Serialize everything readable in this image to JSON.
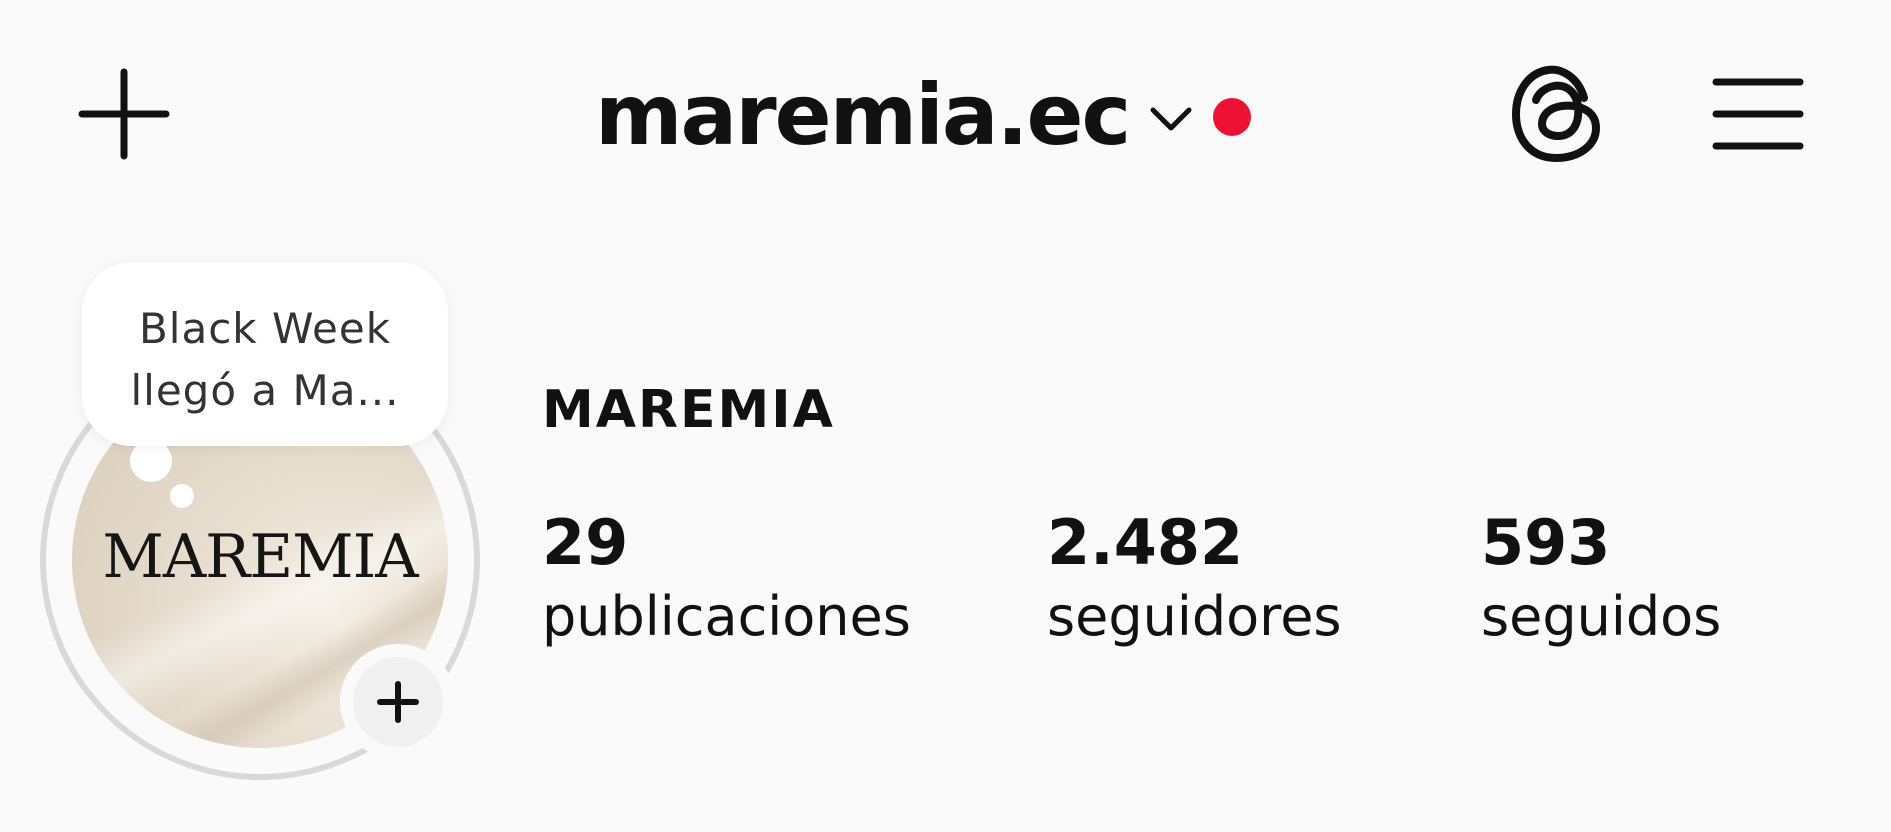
{
  "header": {
    "username": "maremia.ec",
    "new_post_icon": "plus-icon",
    "account_switch_icon": "chevron-down-icon",
    "notification_dot_color": "#ee1133",
    "threads_icon": "threads-icon",
    "menu_icon": "hamburger-menu-icon"
  },
  "profile": {
    "display_name": "MAREMIA",
    "avatar_logo_text": "MAREMIA",
    "note": {
      "line1": "Black Week",
      "line2": "llegó a Ma..."
    },
    "add_story_icon": "plus-icon",
    "stats": [
      {
        "value": "29",
        "label": "publicaciones"
      },
      {
        "value": "2.482",
        "label": "seguidores"
      },
      {
        "value": "593",
        "label": "seguidos"
      }
    ]
  }
}
